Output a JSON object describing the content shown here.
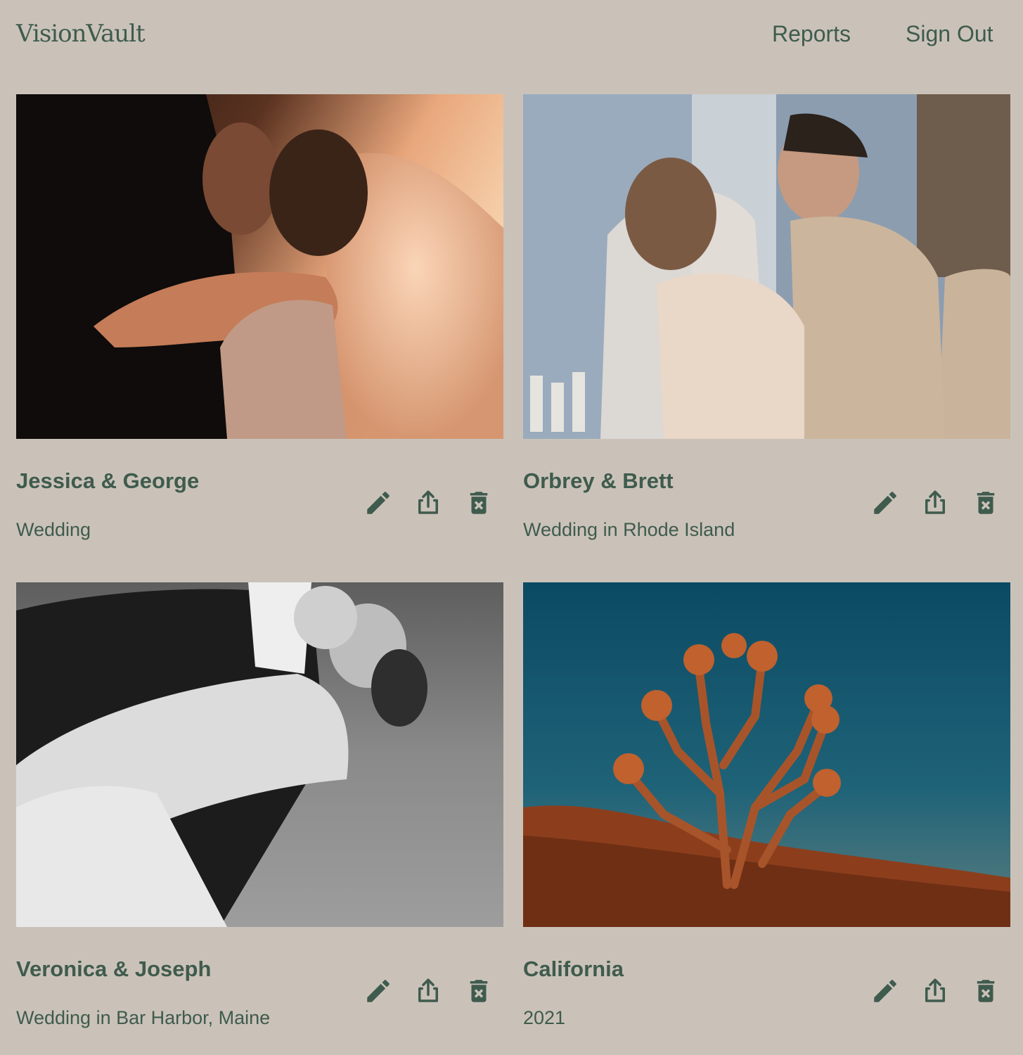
{
  "header": {
    "logo": "VisionVault",
    "nav": {
      "reports": "Reports",
      "sign_out": "Sign Out"
    }
  },
  "colors": {
    "background": "#cac2b8",
    "accent": "#3f5b4e"
  },
  "projects": [
    {
      "title": "Jessica & George",
      "subtitle": "Wedding",
      "image": "couple-kiss-sunset-photo",
      "actions": [
        "pencil-icon",
        "share-icon",
        "trash-icon"
      ]
    },
    {
      "title": "Orbrey & Brett",
      "subtitle": "Wedding in Rhode Island",
      "image": "couple-kiss-ceremony-photo",
      "actions": [
        "pencil-icon",
        "share-icon",
        "trash-icon"
      ]
    },
    {
      "title": "Veronica & Joseph",
      "subtitle": "Wedding in Bar Harbor, Maine",
      "image": "couple-dip-black-white-photo",
      "actions": [
        "pencil-icon",
        "share-icon",
        "trash-icon"
      ]
    },
    {
      "title": "California",
      "subtitle": "2021",
      "image": "joshua-tree-desert-photo",
      "actions": [
        "pencil-icon",
        "share-icon",
        "trash-icon"
      ]
    }
  ]
}
